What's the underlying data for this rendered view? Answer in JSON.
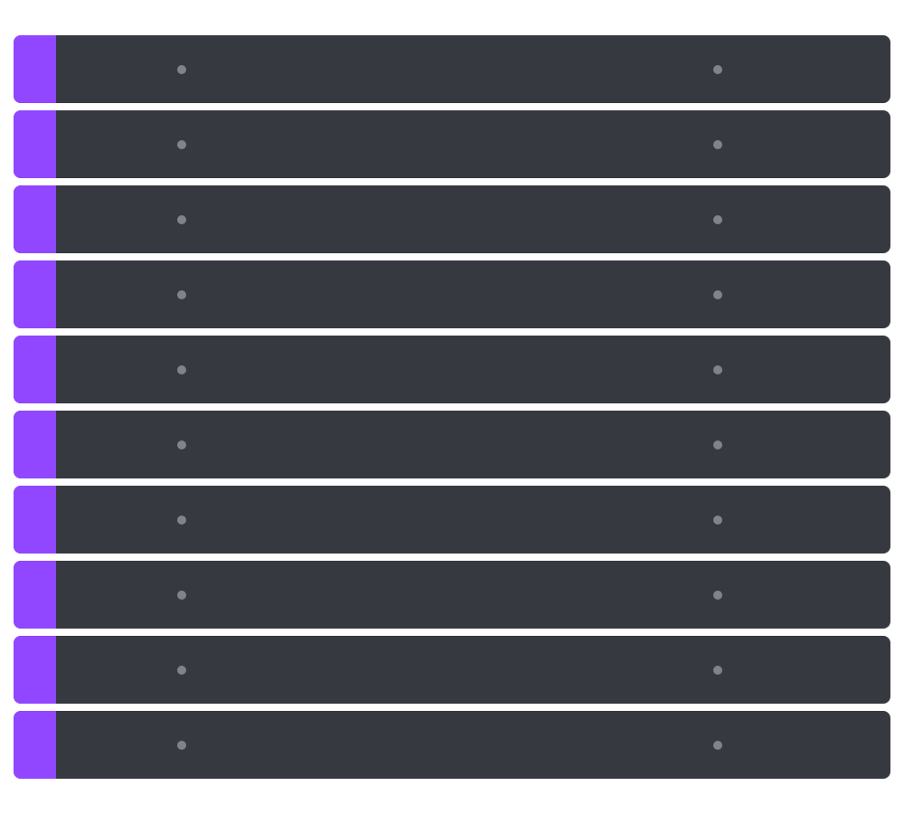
{
  "colors": {
    "accent": "#9146ff",
    "row_background": "#36393f",
    "placeholder_dot": "#808388"
  },
  "rows": [
    {
      "placeholders": 2
    },
    {
      "placeholders": 2
    },
    {
      "placeholders": 2
    },
    {
      "placeholders": 2
    },
    {
      "placeholders": 2
    },
    {
      "placeholders": 2
    },
    {
      "placeholders": 2
    },
    {
      "placeholders": 2
    },
    {
      "placeholders": 2
    },
    {
      "placeholders": 2
    }
  ]
}
